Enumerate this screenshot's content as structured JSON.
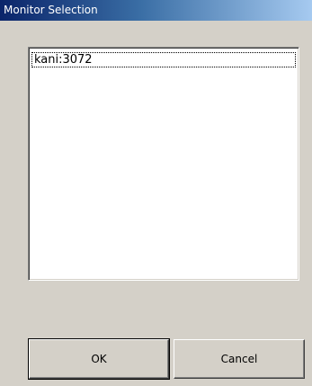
{
  "window": {
    "title": "Monitor Selection"
  },
  "list": {
    "items": [
      {
        "label": "kani:3072"
      }
    ]
  },
  "buttons": {
    "ok_label": "OK",
    "cancel_label": "Cancel"
  }
}
